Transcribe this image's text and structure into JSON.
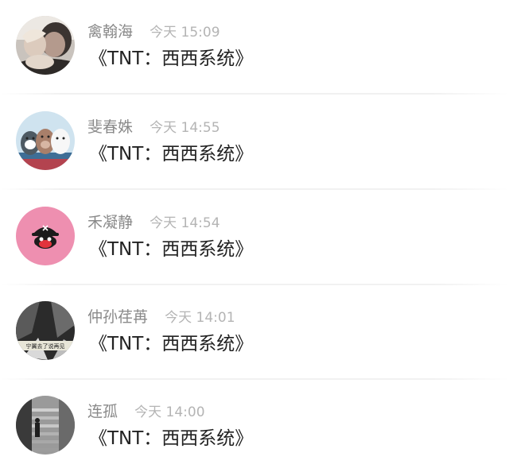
{
  "comments": [
    {
      "name": "禽翰海",
      "time": "今天 15:09",
      "text": "《TNT：西西系统》",
      "avatar": "couple-photo-avatar"
    },
    {
      "name": "斐春姝",
      "time": "今天 14:55",
      "text": "《TNT：西西系统》",
      "avatar": "cartoon-bears-avatar"
    },
    {
      "name": "禾凝静",
      "time": "今天 14:54",
      "text": "《TNT：西西系统》",
      "avatar": "pirate-monkey-avatar"
    },
    {
      "name": "仲孙荏苒",
      "time": "今天 14:01",
      "text": "《TNT：西西系统》",
      "avatar": "dark-text-photo-avatar"
    },
    {
      "name": "连孤",
      "time": "今天 14:00",
      "text": "《TNT：西西系统》",
      "avatar": "stairs-photo-avatar"
    }
  ],
  "avatar_texts": {
    "dark_text_caption": "宁翼去了说再见"
  }
}
